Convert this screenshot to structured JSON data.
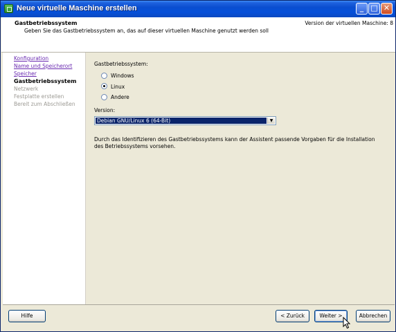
{
  "window": {
    "title": "Neue virtuelle Maschine erstellen",
    "minimize_label": "_",
    "maximize_label": "□",
    "close_label": "✕"
  },
  "header": {
    "title": "Gastbetriebssystem",
    "subtitle": "Geben Sie das Gastbetriebssystem an, das auf dieser virtuellen Maschine genutzt werden soll",
    "version": "Version der virtuellen Maschine: 8"
  },
  "nav": {
    "items": [
      {
        "label": "Konfiguration",
        "state": "link"
      },
      {
        "label": "Name und Speicherort",
        "state": "link"
      },
      {
        "label": "Speicher",
        "state": "link"
      },
      {
        "label": "Gastbetriebssystem",
        "state": "current"
      },
      {
        "label": "Netzwerk",
        "state": "disabled"
      },
      {
        "label": "Festplatte erstellen",
        "state": "disabled"
      },
      {
        "label": "Bereit zum Abschließen",
        "state": "disabled"
      }
    ]
  },
  "main": {
    "os_label": "Gastbetriebssystem:",
    "options": [
      {
        "label": "Windows",
        "checked": false
      },
      {
        "label": "Linux",
        "checked": true
      },
      {
        "label": "Andere",
        "checked": false
      }
    ],
    "version_label": "Version:",
    "version_value": "Debian GNU/Linux 6 (64-Bit)",
    "description": "Durch das Identifizieren des Gastbetriebssystems kann der Assistent passende Vorgaben für die Installation des Betriebssystems vorsehen."
  },
  "footer": {
    "help": "Hilfe",
    "back": "< Zurück",
    "next": "Weiter >",
    "cancel": "Abbrechen"
  },
  "colors": {
    "titlebar": "#0a4ed0",
    "link": "#6a2ab0",
    "selection": "#0a246a",
    "dialog_bg": "#ece9d8"
  }
}
